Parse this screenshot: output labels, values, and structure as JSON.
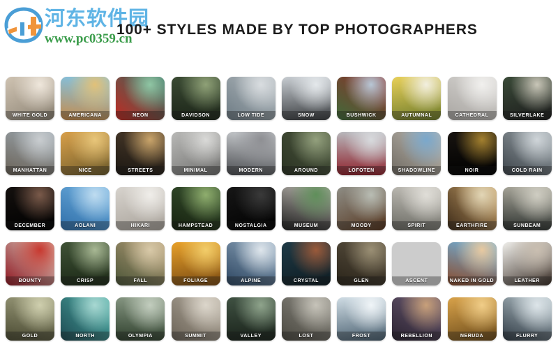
{
  "watermark": {
    "chinese_text": "河东软件园",
    "url_text": "www.pc0359.cn",
    "logo_name": "hedong-software-logo",
    "blue": "#5fb4e5",
    "green": "#3a9c4a",
    "orange": "#f0943a"
  },
  "header": {
    "title": "100+ STYLES MADE BY TOP PHOTOGRAPHERS"
  },
  "grid": {
    "columns": 10,
    "rows": 5,
    "tiles": [
      {
        "label": "WHITE GOLD",
        "c1": "#cfc3b2",
        "c2": "#8a8172",
        "c3": "#efe7dc"
      },
      {
        "label": "AMERICANA",
        "c1": "#7fc4e8",
        "c2": "#c58b4a",
        "c3": "#e2c178"
      },
      {
        "label": "NEON",
        "c1": "#2f6f63",
        "c2": "#c02a22",
        "c3": "#8fc6a4"
      },
      {
        "label": "DAVIDSON",
        "c1": "#3a4a33",
        "c2": "#1d2619",
        "c3": "#8fa177"
      },
      {
        "label": "LOW TIDE",
        "c1": "#b5bcc0",
        "c2": "#6d7b84",
        "c3": "#d9dde0"
      },
      {
        "label": "SNOW",
        "c1": "#c7ccd1",
        "c2": "#3a3d40",
        "c3": "#e4e8eb"
      },
      {
        "label": "BUSHWICK",
        "c1": "#8f2f2a",
        "c2": "#3f6b3a",
        "c3": "#b8c7d6"
      },
      {
        "label": "AUTUMNAL",
        "c1": "#e8d05a",
        "c2": "#6d7a2a",
        "c3": "#f2efe0"
      },
      {
        "label": "CATHEDRAL",
        "c1": "#d8d6d3",
        "c2": "#a9a6a2",
        "c3": "#f1f0ee"
      },
      {
        "label": "SILVERLAKE",
        "c1": "#3a4a38",
        "c2": "#1c1c1c",
        "c3": "#c9c6b8"
      },
      {
        "label": "MANHATTAN",
        "c1": "#9ba6ae",
        "c2": "#6a6257",
        "c3": "#c9cdd0"
      },
      {
        "label": "NICE",
        "c1": "#d9a04a",
        "c2": "#6b5a2a",
        "c3": "#e8c67a"
      },
      {
        "label": "STREETS",
        "c1": "#4a3a2a",
        "c2": "#1b1712",
        "c3": "#c9a46a"
      },
      {
        "label": "MINIMAL",
        "c1": "#b9b9b7",
        "c2": "#6e6e6c",
        "c3": "#dadad8"
      },
      {
        "label": "MODERN",
        "c1": "#cfd2d5",
        "c2": "#4a4c50",
        "c3": "#8e8f93"
      },
      {
        "label": "AROUND",
        "c1": "#4f5a41",
        "c2": "#2a3222",
        "c3": "#93a07d"
      },
      {
        "label": "LOFOTEN",
        "c1": "#b9bcc0",
        "c2": "#8e1f2a",
        "c3": "#d8dadd"
      },
      {
        "label": "SHADOWLINE",
        "c1": "#c2bdb4",
        "c2": "#6f6a62",
        "c3": "#7aa8cc"
      },
      {
        "label": "NOIR",
        "c1": "#181410",
        "c2": "#000000",
        "c3": "#a3802f"
      },
      {
        "label": "COLD RAIN",
        "c1": "#9aa3a8",
        "c2": "#3d444a",
        "c3": "#cfd5d9"
      },
      {
        "label": "DECEMBER",
        "c1": "#14100e",
        "c2": "#000000",
        "c3": "#7a5a4a"
      },
      {
        "label": "AOLANI",
        "c1": "#6fb0e0",
        "c2": "#2f6ea8",
        "c3": "#bfdcf0"
      },
      {
        "label": "HIKARI",
        "c1": "#d7d3cd",
        "c2": "#a8a29a",
        "c3": "#f0eeea"
      },
      {
        "label": "HAMPSTEAD",
        "c1": "#37512f",
        "c2": "#16210f",
        "c3": "#8fae6e"
      },
      {
        "label": "NOSTALGIA",
        "c1": "#161616",
        "c2": "#000000",
        "c3": "#3a3a3a"
      },
      {
        "label": "MUSEUM",
        "c1": "#b6b2ab",
        "c2": "#1d1d1d",
        "c3": "#5f8f5a"
      },
      {
        "label": "MOODY",
        "c1": "#8e8d85",
        "c2": "#54341d",
        "c3": "#b9bdb4"
      },
      {
        "label": "SPIRIT",
        "c1": "#c5c2bb",
        "c2": "#6b6b64",
        "c3": "#e0ded8"
      },
      {
        "label": "EARTHFIRE",
        "c1": "#c9a36a",
        "c2": "#3c2a18",
        "c3": "#e2d6b6"
      },
      {
        "label": "SUNBEAM",
        "c1": "#aaa89c",
        "c2": "#2e3330",
        "c3": "#cfcdc2"
      },
      {
        "label": "BOUNTY",
        "c1": "#ddd3c4",
        "c2": "#8e1520",
        "c3": "#c8382f"
      },
      {
        "label": "CRISP",
        "c1": "#3f5236",
        "c2": "#1d2a17",
        "c3": "#a8b894"
      },
      {
        "label": "FALL",
        "c1": "#b7a07a",
        "c2": "#4a5437",
        "c3": "#d8c9a8"
      },
      {
        "label": "FOLIAGE",
        "c1": "#e8a12a",
        "c2": "#7a4a12",
        "c3": "#f2cd6a"
      },
      {
        "label": "ALPINE",
        "c1": "#8fa7bd",
        "c2": "#2c4560",
        "c3": "#dfe6ec"
      },
      {
        "label": "CRYSTAL",
        "c1": "#1f3a46",
        "c2": "#0e1c22",
        "c3": "#9a5a3a"
      },
      {
        "label": "GLEN",
        "c1": "#5a5040",
        "c2": "#2a2419",
        "c3": "#9a8f74"
      },
      {
        "label": "ASCENT",
        "c1": "#cfcabc",
        "c2": "#7c7668",
        "c3": "#ecead f"
      },
      {
        "label": "NAKED IN GOLD",
        "c1": "#6fb4e0",
        "c2": "#8a4a2a",
        "c3": "#e8c9a0"
      },
      {
        "label": "LEATHER",
        "c1": "#efeeea",
        "c2": "#3a2e26",
        "c3": "#c9beb0"
      },
      {
        "label": "GOLD",
        "c1": "#9a9a7a",
        "c2": "#4a4a32",
        "c3": "#cfcfae"
      },
      {
        "label": "NORTH",
        "c1": "#4fb0a8",
        "c2": "#1d4a52",
        "c3": "#a8d8d2"
      },
      {
        "label": "OLYMPIA",
        "c1": "#8a9a86",
        "c2": "#2e3f2c",
        "c3": "#c2cdbe"
      },
      {
        "label": "SUMMIT",
        "c1": "#b9b1a4",
        "c2": "#6a6256",
        "c3": "#dcd6cb"
      },
      {
        "label": "VALLEY",
        "c1": "#3f5142",
        "c2": "#1a231b",
        "c3": "#8fa48c"
      },
      {
        "label": "LOST",
        "c1": "#8e8c84",
        "c2": "#4a4840",
        "c3": "#c6c3b9"
      },
      {
        "label": "FROST",
        "c1": "#cfdce4",
        "c2": "#4a6070",
        "c3": "#f0f5f8"
      },
      {
        "label": "REBELLION",
        "c1": "#6a5a72",
        "c2": "#2a2230",
        "c3": "#c8a07a"
      },
      {
        "label": "NERUDA",
        "c1": "#d8a24a",
        "c2": "#6a4a1a",
        "c3": "#f0cd88"
      },
      {
        "label": "FLURRY",
        "c1": "#b4c2c8",
        "c2": "#2f3a44",
        "c3": "#dde5e9"
      }
    ]
  }
}
